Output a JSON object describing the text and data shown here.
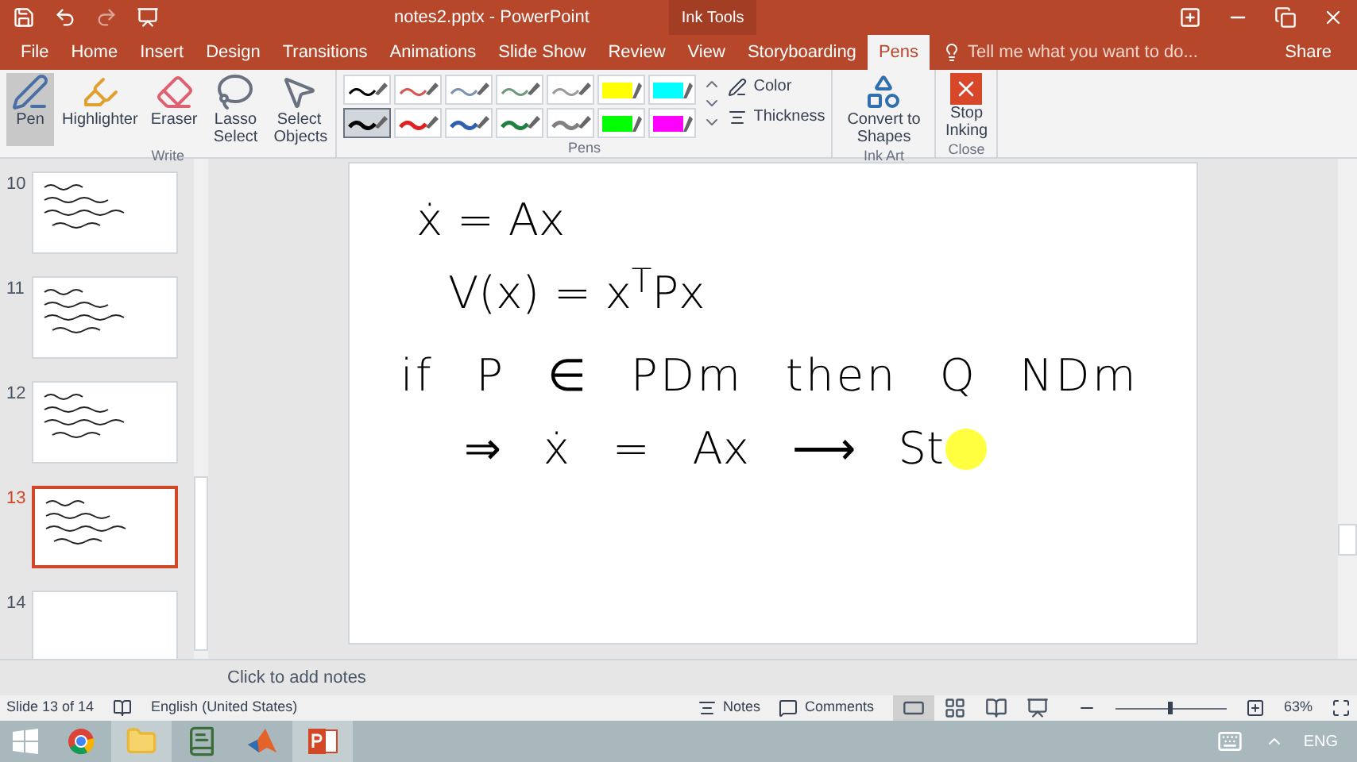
{
  "window": {
    "title": "notes2.pptx - PowerPoint",
    "context_label": "Ink Tools"
  },
  "tabs": [
    {
      "label": "File",
      "selected": false
    },
    {
      "label": "Home",
      "selected": false
    },
    {
      "label": "Insert",
      "selected": false
    },
    {
      "label": "Design",
      "selected": false
    },
    {
      "label": "Transitions",
      "selected": false
    },
    {
      "label": "Animations",
      "selected": false
    },
    {
      "label": "Slide Show",
      "selected": false
    },
    {
      "label": "Review",
      "selected": false
    },
    {
      "label": "View",
      "selected": false
    },
    {
      "label": "Storyboarding",
      "selected": false
    },
    {
      "label": "Pens",
      "selected": true
    }
  ],
  "tell_me": {
    "placeholder": "Tell me what you want to do..."
  },
  "share": "Share",
  "write_group": {
    "label": "Write",
    "tools": [
      {
        "label": "Pen",
        "kind": "pen",
        "selected": true
      },
      {
        "label": "Highlighter",
        "kind": "highlighter",
        "selected": false
      },
      {
        "label": "Eraser",
        "kind": "eraser",
        "selected": false
      },
      {
        "label": "Lasso Select",
        "kind": "lasso",
        "selected": false
      },
      {
        "label": "Select Objects",
        "kind": "pointer",
        "selected": false
      }
    ]
  },
  "pens_group": {
    "label": "Pens",
    "pens": [
      {
        "kind": "line",
        "color": "#000000",
        "selected": false
      },
      {
        "kind": "line",
        "color": "#d9534f",
        "selected": false
      },
      {
        "kind": "line",
        "color": "#7a93b0",
        "selected": false
      },
      {
        "kind": "line",
        "color": "#6f9a7a",
        "selected": false
      },
      {
        "kind": "line",
        "color": "#9a9a9a",
        "selected": false
      },
      {
        "kind": "highlighter",
        "color": "#ffff00",
        "selected": false
      },
      {
        "kind": "highlighter",
        "color": "#00ffff",
        "selected": false
      },
      {
        "kind": "line",
        "color": "#000000",
        "selected": true
      },
      {
        "kind": "line",
        "color": "#e02020",
        "selected": false
      },
      {
        "kind": "line",
        "color": "#2f5fb0",
        "selected": false
      },
      {
        "kind": "line",
        "color": "#1f8040",
        "selected": false
      },
      {
        "kind": "line",
        "color": "#808080",
        "selected": false
      },
      {
        "kind": "highlighter",
        "color": "#00ff00",
        "selected": false
      },
      {
        "kind": "highlighter",
        "color": "#ff00ff",
        "selected": false
      }
    ],
    "color_label": "Color",
    "thickness_label": "Thickness"
  },
  "ink_art_group": {
    "label": "Ink Art",
    "button": "Convert to Shapes"
  },
  "close_group": {
    "label": "Close",
    "button": "Stop Inking"
  },
  "slides": [
    {
      "number": "10",
      "selected": false,
      "kind": "ink"
    },
    {
      "number": "11",
      "selected": false,
      "kind": "ink"
    },
    {
      "number": "12",
      "selected": false,
      "kind": "ink"
    },
    {
      "number": "13",
      "selected": true,
      "kind": "ink"
    },
    {
      "number": "14",
      "selected": false,
      "kind": "blank"
    }
  ],
  "slide": {
    "ink_lines": [
      "ẋ = Ax",
      "V(x) = x$^{T}$Px",
      "if P ∈ PDm then Q NDm",
      "⇒ ẋ = Ax ⟶ St"
    ]
  },
  "notes_placeholder": "Click to add notes",
  "status_bar": {
    "slide_info": "Slide 13 of 14",
    "language": "English (United States)",
    "notes": "Notes",
    "comments": "Comments",
    "views": [
      {
        "kind": "normal",
        "selected": true
      },
      {
        "kind": "sorter",
        "selected": false
      },
      {
        "kind": "reading",
        "selected": false
      },
      {
        "kind": "show",
        "selected": false
      }
    ],
    "zoom": {
      "level": 0.5
    },
    "zoom_reading": "63%"
  },
  "taskbar": {
    "apps": [
      {
        "kind": "chrome",
        "selected": false
      },
      {
        "kind": "explorer",
        "selected": true
      },
      {
        "kind": "app",
        "selected": false
      },
      {
        "kind": "matlab",
        "selected": false
      },
      {
        "kind": "powerpoint",
        "selected": true
      }
    ],
    "language": "ENG"
  }
}
